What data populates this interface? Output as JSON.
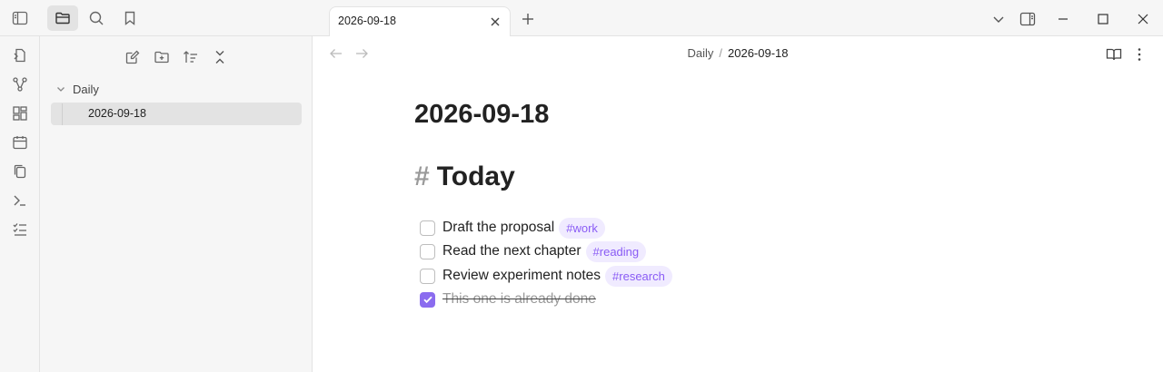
{
  "tab": {
    "title": "2026-09-18"
  },
  "explorer": {
    "folder": "Daily",
    "file": "2026-09-18"
  },
  "breadcrumb": {
    "parent": "Daily",
    "separator": "/",
    "current": "2026-09-18"
  },
  "note": {
    "title": "2026-09-18",
    "heading_hash": "#",
    "heading": "Today",
    "tasks": [
      {
        "text": "Draft the proposal",
        "tag": "#work",
        "done": false
      },
      {
        "text": "Read the next chapter",
        "tag": "#reading",
        "done": false
      },
      {
        "text": "Review experiment notes",
        "tag": "#research",
        "done": false
      },
      {
        "text": "This one is already done",
        "tag": "",
        "done": true
      }
    ]
  },
  "colors": {
    "accent": "#8b6cef",
    "tag_text": "#8a5cf5",
    "tag_bg": "#f0ebff",
    "sidebar_bg": "#f6f6f6"
  },
  "icons": [
    "sidebar-toggle-icon",
    "folder-icon",
    "search-icon",
    "bookmark-icon",
    "new-note-icon",
    "new-folder-icon",
    "sort-icon",
    "collapse-icon",
    "close-icon",
    "plus-icon",
    "chevron-down-icon",
    "right-sidebar-icon",
    "minimize-icon",
    "maximize-icon",
    "back-icon",
    "forward-icon",
    "reading-view-icon",
    "more-options-icon"
  ]
}
